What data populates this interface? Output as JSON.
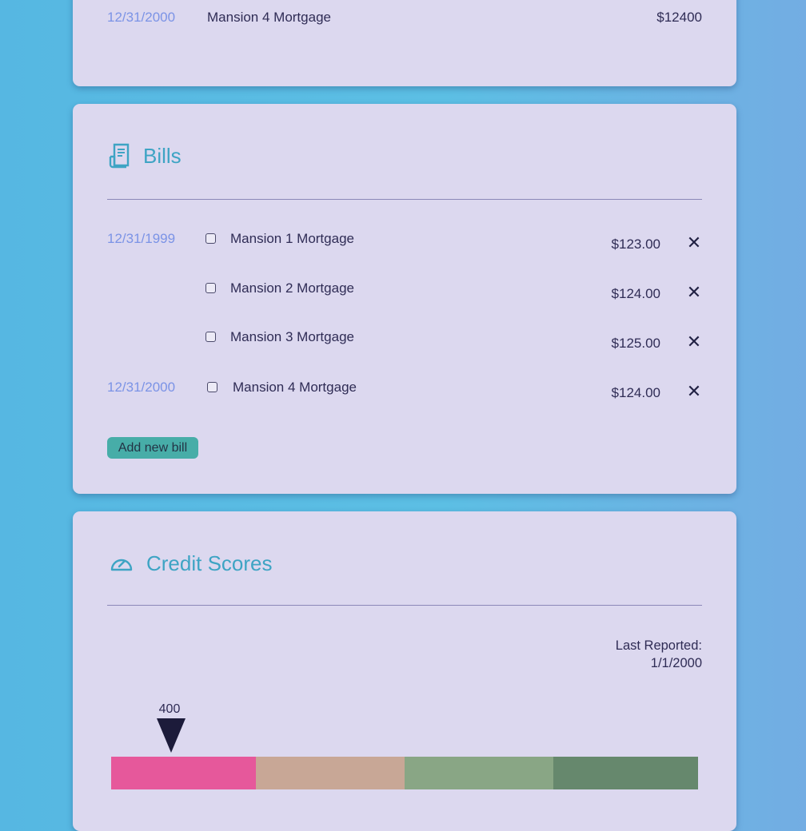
{
  "top_card": {
    "row": {
      "date": "12/31/2000",
      "name": "Mansion 4 Mortgage",
      "amount": "$12400"
    }
  },
  "bills": {
    "title": "Bills",
    "icon": "receipt-icon",
    "rows": [
      {
        "date": "12/31/1999",
        "name": "Mansion 1 Mortgage",
        "amount": "$123.00"
      },
      {
        "date": "",
        "name": "Mansion 2 Mortgage",
        "amount": "$124.00"
      },
      {
        "date": "",
        "name": "Mansion 3 Mortgage",
        "amount": "$125.00"
      },
      {
        "date": "12/31/2000",
        "name": "Mansion 4 Mortgage",
        "amount": "$124.00"
      }
    ],
    "delete_glyph": "✕",
    "add_label": "Add new bill"
  },
  "credit": {
    "title": "Credit Scores",
    "icon": "gauge-icon",
    "last_reported_label": "Last Reported:",
    "last_reported_date": "1/1/2000",
    "score": "400",
    "bar_colors": [
      "#e6589b",
      "#c8a796",
      "#89a685",
      "#66886d"
    ]
  }
}
